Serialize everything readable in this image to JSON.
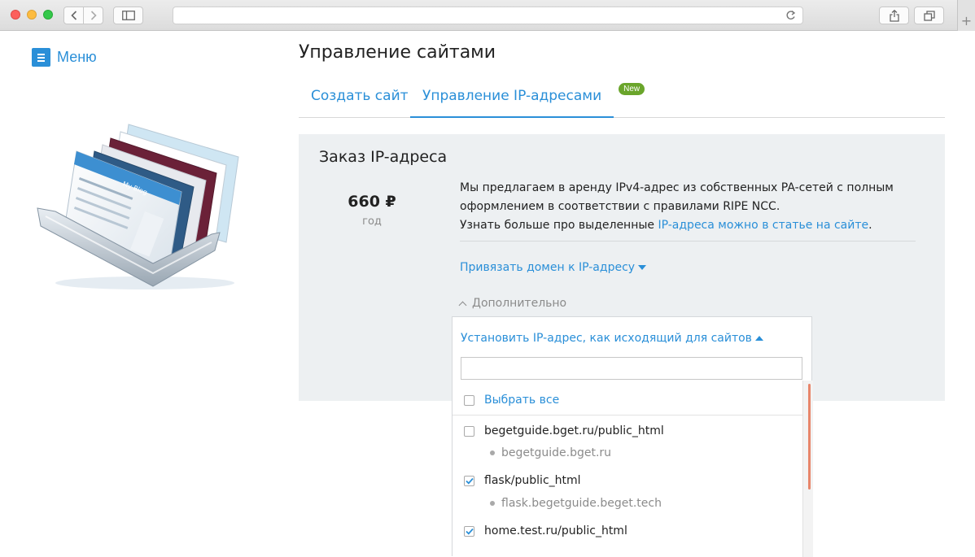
{
  "browser": {
    "address": "",
    "icons": [
      "back-icon",
      "forward-icon",
      "sidebar-icon",
      "reload-icon",
      "share-icon",
      "tabs-icon",
      "new-tab-icon"
    ]
  },
  "sidebar": {
    "menu_label": "Меню"
  },
  "main": {
    "title": "Управление сайтами",
    "tabs": [
      {
        "label": "Создать сайт",
        "active": false
      },
      {
        "label": "Управление IP-адресами",
        "active": true,
        "badge": "New"
      }
    ]
  },
  "order": {
    "title": "Заказ IP-адреса",
    "price": "660 ₽",
    "period": "год",
    "description_line1": "Мы предлагаем в аренду IPv4-адрес из собственных PA-сетей с полным",
    "description_line2": "оформлением в соответствии с правилами RIPE NCC.",
    "learn_more_prefix": "Узнать больше про выделенные ",
    "learn_more_link": "IP-адреса можно в статье на сайте",
    "learn_more_suffix": ".",
    "bind_domain_link": "Привязать домен к IP-адресу",
    "extra_label": "Дополнительно"
  },
  "popup": {
    "set_outgoing_link": "Установить IP-адрес, как исходящий для сайтов",
    "search_value": "",
    "select_all_label": "Выбрать все",
    "select_all_checked": false,
    "sites": [
      {
        "path": "begetguide.bget.ru/public_html",
        "domain": "begetguide.bget.ru",
        "checked": false
      },
      {
        "path": "flask/public_html",
        "domain": "flask.begetguide.beget.tech",
        "checked": true
      },
      {
        "path": "home.test.ru/public_html",
        "domain": "",
        "checked": true
      }
    ]
  },
  "colors": {
    "accent": "#2a8fd8",
    "badge": "#6aa52b",
    "panel_bg": "#edf0f2",
    "scroll_thumb": "#e8866b"
  }
}
